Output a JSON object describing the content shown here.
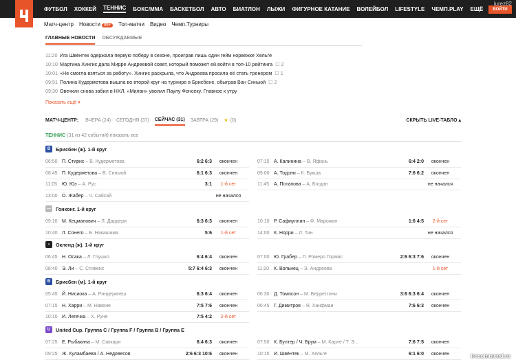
{
  "brand": {
    "accent": "#e8542a",
    "topbar": "#1f1f1f"
  },
  "nav": [
    "ФУТБОЛ",
    "ХОККЕЙ",
    "ТЕННИС",
    "БОКС/ММА",
    "БАСКЕТБОЛ",
    "АВТО",
    "БИАТЛОН",
    "ЛЫЖИ",
    "ФИГУРНОЕ КАТАНИЕ",
    "ВОЛЕЙБОЛ",
    "LIFESTYLE",
    "ЧЕМП.PLAY",
    "ЕЩЁ"
  ],
  "user": "jurez82",
  "login": "ВОЙТИ",
  "subnav": {
    "items": [
      "Матч-центр",
      "Новости",
      "Топ-матчи",
      "Видео",
      "Чемп.Турниры"
    ],
    "badge": "99+"
  },
  "newstabs": [
    "ГЛАВНЫЕ НОВОСТИ",
    "ОБСУЖДАЕМЫЕ"
  ],
  "news": [
    {
      "t": "11:20",
      "h": "Ига Швёнтек одержала первую победу в сезоне, проиграв лишь один гейм норвежке Хельгё",
      "c": ""
    },
    {
      "t": "10:10",
      "h": "Мартина Хингис дала Мирре Андреевой совет, который поможет ей войти в топ-10 рейтинга",
      "c": "2"
    },
    {
      "t": "10:01",
      "h": "«Не смогла взяться за работу». Хингис раскрыла, что Андреева просила её стать тренером",
      "c": "1"
    },
    {
      "t": "09:51",
      "h": "Полина Кудерметова вышла во второй круг на турнире в Брисбене, обыграв Ван Синьюй",
      "c": "2"
    },
    {
      "t": "09:30",
      "h": "Овечкин снова забил в НХЛ, «Милан» уволил Паулу Фонсеку. Главное к утру",
      "c": ""
    }
  ],
  "more": "Показать ещё",
  "matchcenter": {
    "label": "МАТЧ-ЦЕНТР:",
    "tabs": [
      "ВЧЕРА (24)",
      "СЕГОДНЯ (37)",
      "СЕЙЧАС (31)",
      "ЗАВТРА (29)"
    ],
    "fav": "(0)",
    "live": "СКРЫТЬ LIVE-ТАБЛО"
  },
  "sport": {
    "name": "ТЕННИС",
    "count": "(31 из 42 событий) показать все"
  },
  "tournaments": [
    {
      "name": "Брисбен (ж). 1-й круг",
      "icon": "B",
      "color": "#2b4fa5"
    },
    {
      "name": "Гонконг. 1-й круг",
      "icon": "—",
      "color": "#bbb"
    },
    {
      "name": "Окленд (ж). 1-й круг",
      "icon": "▪",
      "color": "#222"
    },
    {
      "name": "Брисбен (м). 1-й круг",
      "icon": "B",
      "color": "#2b4fa5"
    },
    {
      "name": "United Cup. Группа С / Группа F / Группа В / Группа Е",
      "icon": "U",
      "color": "#7b4bc9"
    }
  ],
  "left": [
    [
      {
        "t": "06:50",
        "p": "П. Стирнс",
        "o": "В. Кудерметова",
        "s": "6:2  6:3",
        "st": "окончен",
        "r": 0
      },
      {
        "t": "08:45",
        "p": "П. Кудерметова",
        "o": "В. Синьюй",
        "s": "6:1  6:3",
        "st": "окончен",
        "r": 0
      },
      {
        "t": "11:05",
        "p": "Ю. Юэ",
        "o": "А. Рус",
        "s": "3:1",
        "st": "1-й сет",
        "r": 1
      },
      {
        "t": "13:00",
        "p": "О. Жабер",
        "o": "Ч. Сайсай",
        "s": "",
        "st": "не начался",
        "r": 0
      }
    ],
    [
      {
        "t": "09:10",
        "p": "М. Кецманович",
        "o": "Л. Дардери",
        "s": "6:3  6:3",
        "st": "окончен",
        "r": 0
      },
      {
        "t": "10:40",
        "p": "Л. Сонего",
        "o": "Б. Накашима",
        "s": "5:6",
        "st": "1-й сет",
        "r": 1
      }
    ],
    [
      {
        "t": "06:45",
        "p": "Н. Осака",
        "o": "Л. Глушко",
        "s": "6:4  6:4",
        "st": "окончен",
        "r": 0
      },
      {
        "t": "08:40",
        "p": "Э. Ли",
        "o": "С. Стивенс",
        "s": "5:7  6:4  6:3",
        "st": "окончен",
        "r": 0
      }
    ],
    [
      {
        "t": "05:45",
        "p": "Й. Нисиока",
        "o": "А. Риндеркнеш",
        "s": "6:3  6:4",
        "st": "окончен",
        "r": 0
      },
      {
        "t": "07:15",
        "p": "Н. Харри",
        "o": "М. Навоне",
        "s": "7:5  7:6",
        "st": "окончен",
        "r": 0
      },
      {
        "t": "10:10",
        "p": "И. Легечка",
        "o": "Х. Руне",
        "s": "7:5  4:2",
        "st": "2-й сет",
        "r": 1
      }
    ],
    [
      {
        "t": "07:25",
        "p": "Е. Рыбакина",
        "o": "М. Саккари",
        "s": "6:4  6:3",
        "st": "окончен",
        "r": 0
      },
      {
        "t": "09:25",
        "p": "Ж. Куламбаева / А. Недовесов",
        "o": "",
        "s": "2:6  6:3  10:6",
        "st": "окончен",
        "r": 0
      }
    ]
  ],
  "right": [
    [
      {
        "t": "07:15",
        "p": "А. Калинина",
        "o": "В. Яфань",
        "s": "6:4  2:0",
        "st": "окончен",
        "r": 0
      },
      {
        "t": "09:00",
        "p": "А. Тодони",
        "o": "К. Букша",
        "s": "7:6  6:2",
        "st": "окончен",
        "r": 0
      },
      {
        "t": "11:45",
        "p": "А. Потапова",
        "o": "А. Богдан",
        "s": "",
        "st": "не начался",
        "r": 0
      }
    ],
    [
      {
        "t": "10:10",
        "p": "Р. Сафиуллин",
        "o": "Ф. Марожан",
        "s": "1:6  4:5",
        "st": "2-й сет",
        "r": 1
      },
      {
        "t": "14:00",
        "p": "К. Норри",
        "o": "Л. Тин",
        "s": "",
        "st": "не начался",
        "r": 0
      }
    ],
    [
      {
        "t": "07:00",
        "p": "Ю. Грабер",
        "o": "Л. Ромеро Гормас",
        "s": "2:6  6:3  7:6",
        "st": "окончен",
        "r": 0
      },
      {
        "t": "11:20",
        "p": "К. Вольнец",
        "o": "Э. Андреева",
        "s": "",
        "st": "1-й сет",
        "r": 1
      }
    ],
    [
      {
        "t": "06:30",
        "p": "Д. Томпсон",
        "o": "М. Берреттини",
        "s": "3:6  6:3  6:4",
        "st": "окончен",
        "r": 0
      },
      {
        "t": "06:45",
        "p": "Г. Димитров",
        "o": "Я. Ханфман",
        "s": "7:6  6:3",
        "st": "окончен",
        "r": 0
      }
    ],
    [
      {
        "t": "07:50",
        "p": "К. Бултер / Ч. Брум",
        "o": "М. Карле / Т. Э...",
        "s": "7:6  7:5",
        "st": "окончен",
        "r": 0
      },
      {
        "t": "10:15",
        "p": "И. Швёнтек",
        "o": "М. Хельгё",
        "s": "6:1  6:0",
        "st": "окончен",
        "r": 0
      }
    ]
  ],
  "watermark": "irecommend.ru"
}
